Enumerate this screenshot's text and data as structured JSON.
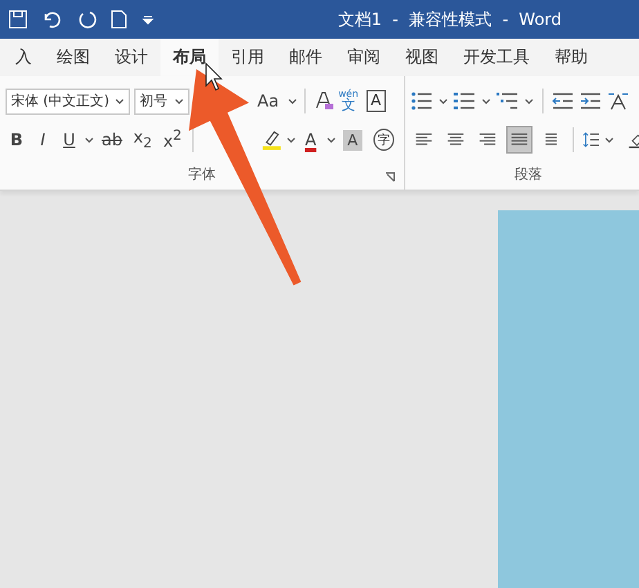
{
  "title_bar": {
    "title": "文档1  -  兼容性模式  -  Word"
  },
  "tabs": [
    {
      "label": "入",
      "selected": false
    },
    {
      "label": "绘图",
      "selected": false
    },
    {
      "label": "设计",
      "selected": false
    },
    {
      "label": "布局",
      "selected": true
    },
    {
      "label": "引用",
      "selected": false
    },
    {
      "label": "邮件",
      "selected": false
    },
    {
      "label": "审阅",
      "selected": false
    },
    {
      "label": "视图",
      "selected": false
    },
    {
      "label": "开发工具",
      "selected": false
    },
    {
      "label": "帮助",
      "selected": false
    }
  ],
  "font_group": {
    "label": "字体",
    "font_name": "宋体 (中文正文)",
    "font_size": "初号",
    "change_case": "Aa",
    "phonetic_top": "wén",
    "phonetic_bottom": "文",
    "border_char": "A",
    "bold": "B",
    "italic": "I",
    "underline": "U",
    "strikethrough": "ab",
    "subscript": "x$_{2}$",
    "superscript": "x$^{2}$",
    "font_color": "A",
    "shading_char": "A",
    "enclose_char": "字"
  },
  "paragraph_group": {
    "label": "段落",
    "alignments": [
      {
        "selected": false
      },
      {
        "selected": false
      },
      {
        "selected": false
      },
      {
        "selected": true
      },
      {
        "selected": false
      }
    ]
  }
}
